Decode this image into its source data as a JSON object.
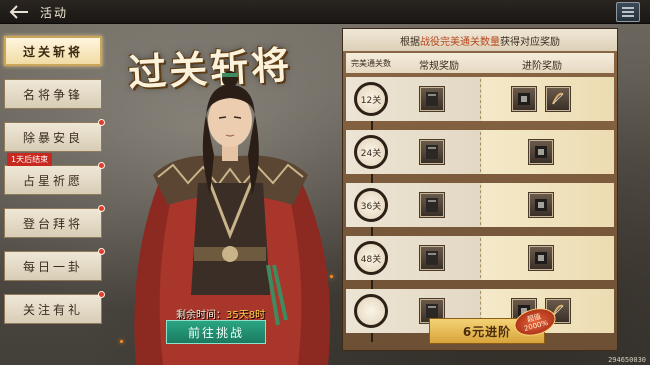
{
  "topbar": {
    "back_icon": "back-arrow-icon",
    "title": "活动",
    "menu_icon": "menu-icon"
  },
  "tabs": [
    {
      "label": "过关斩将",
      "active": true,
      "dot": false
    },
    {
      "label": "名将争锋",
      "active": false,
      "dot": false
    },
    {
      "label": "除暴安良",
      "active": false,
      "dot": true
    },
    {
      "label": "占星祈愿",
      "active": false,
      "dot": true
    },
    {
      "label": "登台拜将",
      "active": false,
      "dot": true
    },
    {
      "label": "每日一卦",
      "active": false,
      "dot": true
    },
    {
      "label": "关注有礼",
      "active": false,
      "dot": true
    }
  ],
  "tab_badge": "1天后结束",
  "hero": {
    "title": "过关斩将",
    "time_label": "剩余时间：",
    "time_value": "35天8时",
    "challenge_button": "前往挑战"
  },
  "panel": {
    "header_prefix": "根据",
    "header_highlight": "战役完美通关数量",
    "header_suffix": "获得对应奖励",
    "col_level": "完美通关数",
    "col_normal": "常规奖励",
    "col_advanced": "进阶奖励",
    "rows": [
      {
        "level": "12关",
        "normal": [
          "item-scroll-icon"
        ],
        "advanced": [
          "item-book-icon",
          "item-bow-icon"
        ]
      },
      {
        "level": "24关",
        "normal": [
          "item-scroll-icon"
        ],
        "advanced": [
          "item-book-icon"
        ]
      },
      {
        "level": "36关",
        "normal": [
          "item-scroll-icon"
        ],
        "advanced": [
          "item-book-icon"
        ]
      },
      {
        "level": "48关",
        "normal": [
          "item-scroll-icon"
        ],
        "advanced": [
          "item-book-icon"
        ]
      },
      {
        "level": "",
        "normal": [
          "item-scroll-icon"
        ],
        "advanced": [
          "item-book-icon",
          "item-bow-icon"
        ]
      }
    ],
    "advance_button": "6元进阶",
    "rebate_top": "超值",
    "rebate_bottom": "2000%"
  },
  "footer_id": "294650030",
  "colors": {
    "accent_green": "#1b7a61",
    "accent_gold": "#d8a43b",
    "badge_red": "#c8281e",
    "time_yellow": "#f5d04a"
  }
}
